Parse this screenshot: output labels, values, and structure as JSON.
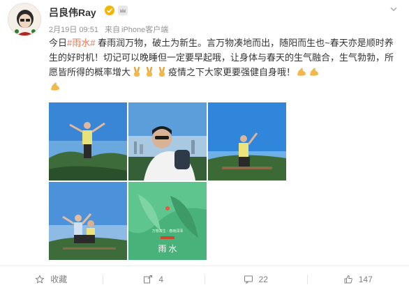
{
  "user": {
    "name": "吕良伟Ray",
    "verified": "verified-badge-icon",
    "member_badge": "crown-icon"
  },
  "meta": {
    "date": "2月19日 09:51",
    "source_prefix": "来自",
    "source": "iPhone客户端"
  },
  "post": {
    "text_before": "今日",
    "hashtag": "#雨水#",
    "text_after": " 春雨润万物，破土为新生。言万物凑地而出，随阳而生也~春天亦是顺时养生的好时机！切记可以晚睡但一定要早起哦，让身体与春天的生气融合，生气勃勃，所愿皆所得的概率增大",
    "text_mid": "疫情之下大家更要强健自身哦！",
    "emoji_victory": "victory-hand-emoji",
    "emoji_muscle": "flexed-biceps-emoji"
  },
  "images": {
    "poster_caption": "雨 水",
    "poster_sub": "万物凑生 · 春雨润泽"
  },
  "actions": {
    "collect": "收藏",
    "repost": "4",
    "comment": "22",
    "like": "147"
  },
  "colors": {
    "hashtag": "#eb7350",
    "text": "#333333",
    "meta": "#939393",
    "badge": "#f5b400"
  }
}
